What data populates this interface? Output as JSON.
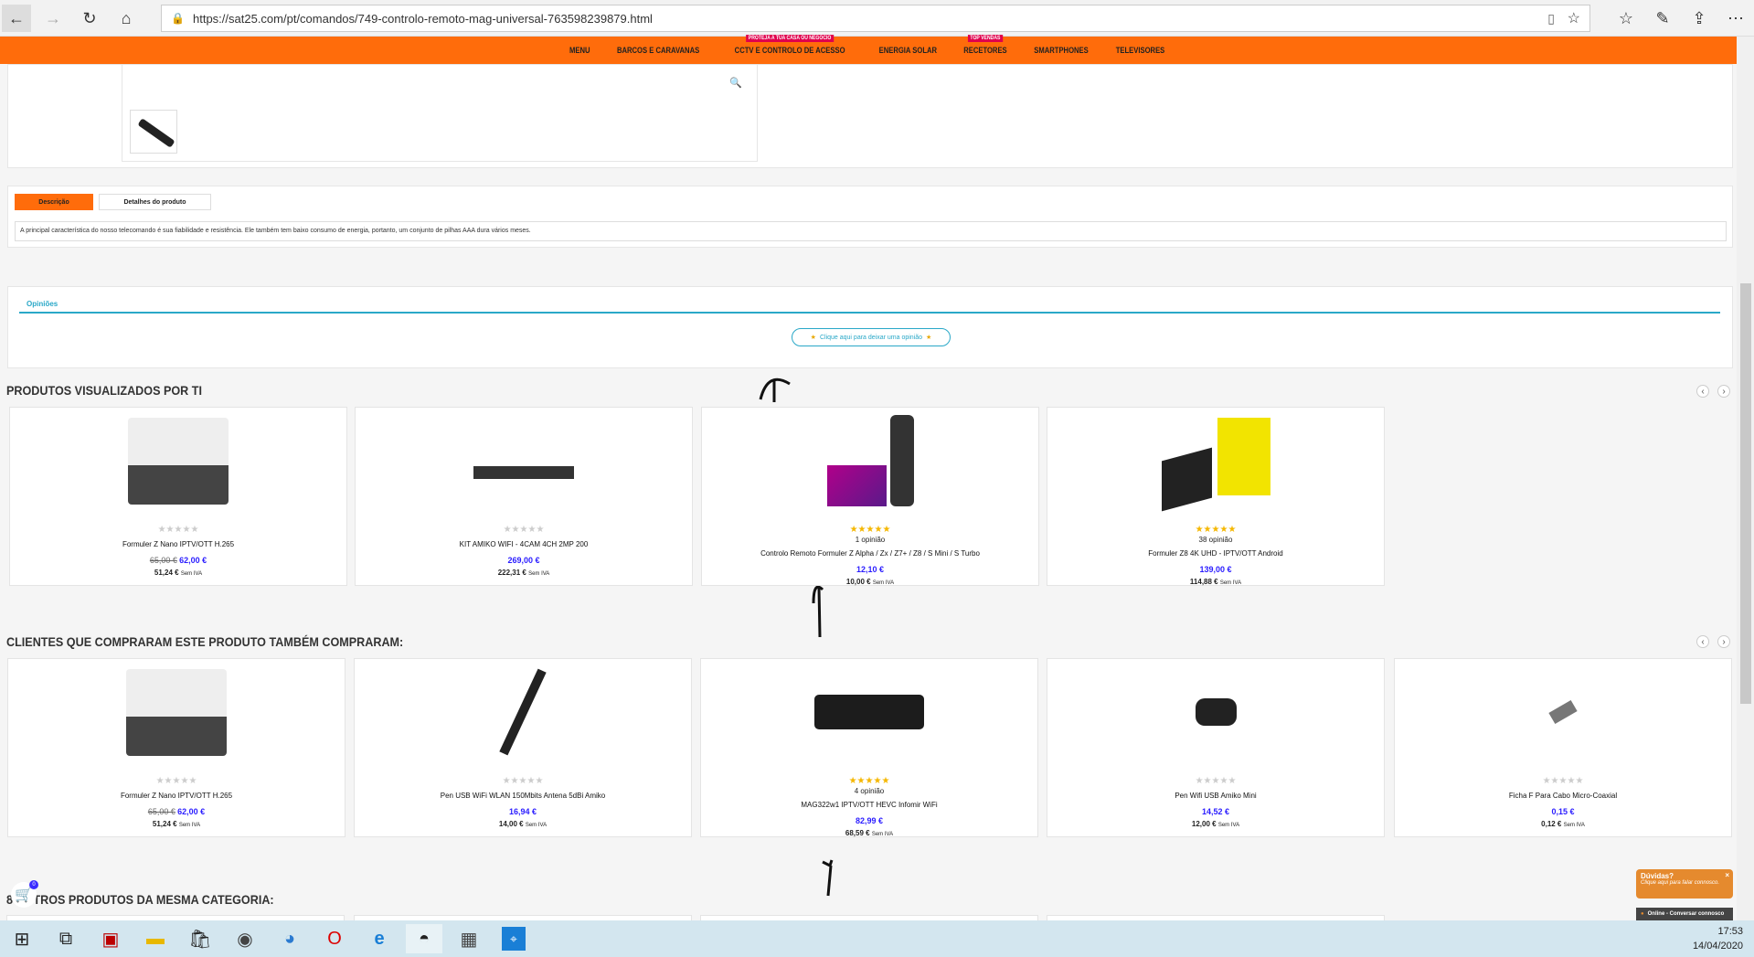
{
  "browser": {
    "url": "https://sat25.com/pt/comandos/749-controlo-remoto-mag-universal-763598239879.html"
  },
  "nav": {
    "items": [
      {
        "label": "MENU"
      },
      {
        "label": "BARCOS E CARAVANAS"
      },
      {
        "label": "CCTV E CONTROLO DE ACESSO",
        "badge": "PROTEJA A TUA CASA OU NEGÓCIO"
      },
      {
        "label": "ENERGIA SOLAR"
      },
      {
        "label": "RECETORES",
        "badge": "TOP VENDAS"
      },
      {
        "label": "SMARTPHONES"
      },
      {
        "label": "TELEVISORES"
      }
    ],
    "color": "#ff6c0b"
  },
  "tabs": {
    "description": "Descrição",
    "details": "Detalhes do produto",
    "text": "A principal característica do nosso telecomando é sua fiabilidade e resistência. Ele também tem baixo consumo de energia, portanto, um conjunto de pilhas AAA dura vários meses."
  },
  "reviews": {
    "tab": "Opiniões",
    "button": "Clique aqui para deixar uma opinião"
  },
  "viewed": {
    "title": "PRODUTOS VISUALIZADOS POR TI",
    "products": [
      {
        "name": "Formuler Z Nano IPTV/OTT H.265",
        "old": "65,00 €",
        "price": "62,00 €",
        "net": "51,24 €",
        "rated": false,
        "img": "box"
      },
      {
        "name": "KIT AMIKO WIFI - 4CAM 4CH 2MP 200",
        "price": "269,00 €",
        "net": "222,31 €",
        "rated": false,
        "img": "cctv"
      },
      {
        "name": "Controlo Remoto Formuler Z Alpha / Zx / Z7+ / Z8 / S Mini / S Turbo",
        "opinions": "1 opinião",
        "price": "12,10 €",
        "net": "10,00 €",
        "rated": true,
        "img": "remote"
      },
      {
        "name": "Formuler Z8 4K UHD - IPTV/OTT Android",
        "opinions": "38 opinião",
        "price": "139,00 €",
        "net": "114,88 €",
        "rated": true,
        "img": "z8"
      }
    ]
  },
  "bought": {
    "title": "CLIENTES QUE COMPRARAM ESTE PRODUTO TAMBÉM COMPRARAM:",
    "products": [
      {
        "name": "Formuler Z Nano IPTV/OTT H.265",
        "old": "65,00 €",
        "price": "62,00 €",
        "net": "51,24 €",
        "rated": false,
        "img": "box"
      },
      {
        "name": "Pen USB WiFi WLAN 150Mbits Antena 5dBi Amiko",
        "price": "16,94 €",
        "net": "14,00 €",
        "rated": false,
        "img": "antenna"
      },
      {
        "name": "MAG322w1 IPTV/OTT HEVC Infomir WiFi",
        "opinions": "4 opinião",
        "price": "82,99 €",
        "net": "68,59 €",
        "rated": true,
        "img": "mag"
      },
      {
        "name": "Pen Wifi USB Amiko Mini",
        "price": "14,52 €",
        "net": "12,00 €",
        "rated": false,
        "img": "usb"
      },
      {
        "name": "Ficha F Para Cabo Micro-Coaxial",
        "price": "0,15 €",
        "net": "0,12 €",
        "rated": false,
        "img": "plug"
      }
    ]
  },
  "tax_label": "Sem IVA",
  "other": {
    "title": "8 OUTROS PRODUTOS DA MESMA CATEGORIA:"
  },
  "cart": {
    "count": "0"
  },
  "chat": {
    "title": "Dúvidas?",
    "subtitle": "Clique aqui para falar connosco.",
    "status": "Online - Conversar connosco"
  },
  "clock": {
    "time": "17:53",
    "date": "14/04/2020"
  }
}
